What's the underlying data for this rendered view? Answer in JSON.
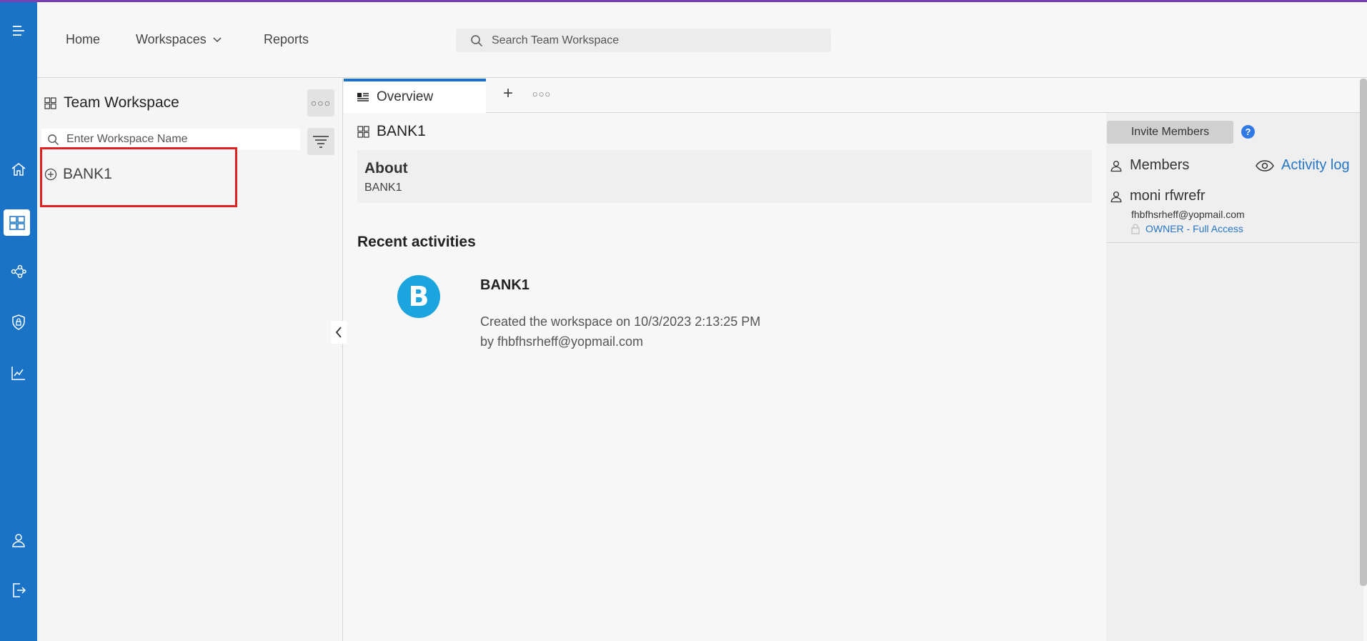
{
  "nav": {
    "home": "Home",
    "workspaces": "Workspaces",
    "reports": "Reports"
  },
  "search": {
    "placeholder": "Search Team Workspace"
  },
  "left_panel": {
    "title": "Team Workspace",
    "search_placeholder": "Enter Workspace Name",
    "workspaces": [
      {
        "name": "BANK1"
      }
    ]
  },
  "tabs": {
    "active": "Overview"
  },
  "workspace": {
    "name": "BANK1",
    "about_heading": "About",
    "about_value": "BANK1"
  },
  "activities": {
    "heading": "Recent activities",
    "items": [
      {
        "avatar_letter": "B",
        "title": "BANK1",
        "line1": "Created the workspace on 10/3/2023 2:13:25 PM",
        "line2": "by fhbfhsrheff@yopmail.com"
      }
    ]
  },
  "members_panel": {
    "invite_label": "Invite Members",
    "help_label": "?",
    "members_heading": "Members",
    "activity_log_label": "Activity log",
    "members": [
      {
        "name": "moni rfwrefr",
        "email": "fhbfhsrheff@yopmail.com",
        "role": "OWNER - Full Access"
      }
    ]
  },
  "colors": {
    "rail": "#1a73c7",
    "accent_stripe": "#7b3fb3",
    "link": "#2676c9",
    "highlight": "#e02020",
    "avatar": "#1ba4de"
  },
  "icons": {
    "rail": [
      "hamburger-icon",
      "home-icon",
      "workspace-icon",
      "share-network-icon",
      "shield-lock-icon",
      "chart-icon",
      "user-icon",
      "logout-icon"
    ]
  }
}
